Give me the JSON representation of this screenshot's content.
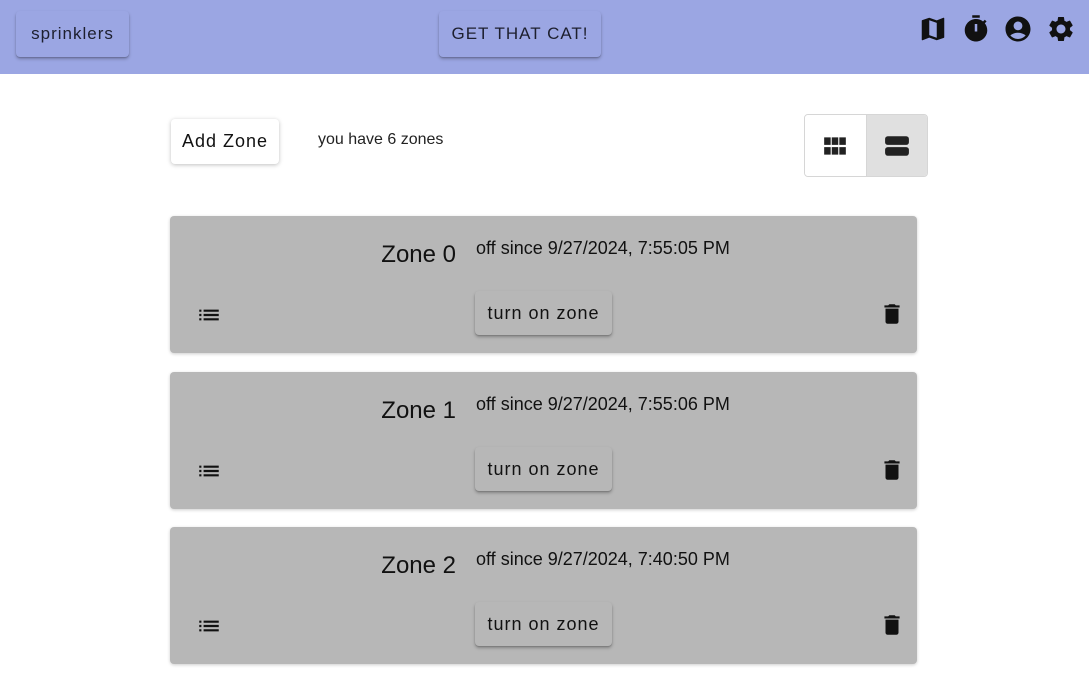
{
  "header": {
    "app_button_label": "sprinklers",
    "cat_button_label": "GET THAT CAT!",
    "icons": [
      "map-icon",
      "timer-icon",
      "account-icon",
      "settings-icon"
    ],
    "bar_color": "#9ba6e3"
  },
  "toolbar": {
    "add_zone_label": "Add Zone",
    "zone_count_text": "you have 6 zones",
    "view_options": [
      "grid-view-icon",
      "row-view-icon"
    ],
    "selected_view": "row-view-icon"
  },
  "zones": [
    {
      "title": "Zone 0",
      "status": "off since 9/27/2024, 7:55:05 PM",
      "action_label": "turn on zone"
    },
    {
      "title": "Zone 1",
      "status": "off since 9/27/2024, 7:55:06 PM",
      "action_label": "turn on zone"
    },
    {
      "title": "Zone 2",
      "status": "off since 9/27/2024, 7:40:50 PM",
      "action_label": "turn on zone"
    }
  ],
  "colors": {
    "card_background": "#b7b7b7",
    "selected_toggle": "#e0e0e0"
  }
}
